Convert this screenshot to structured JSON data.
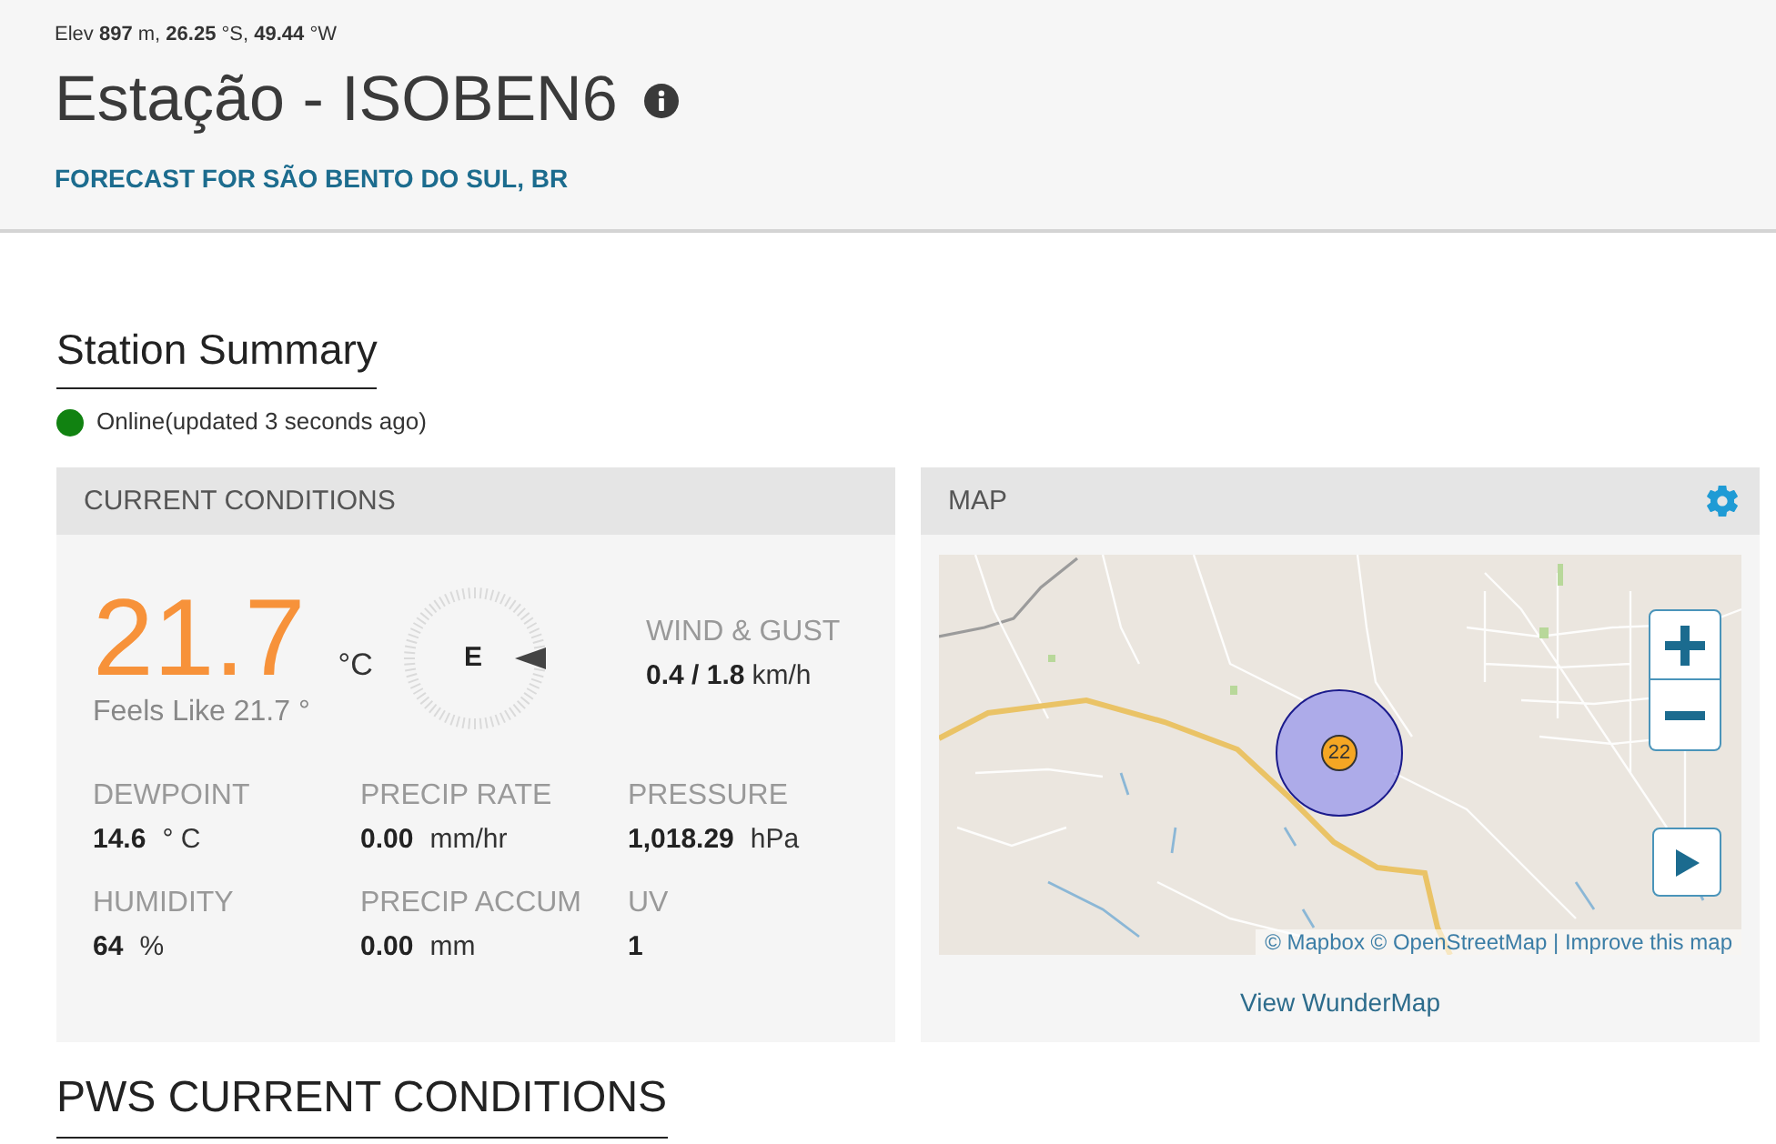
{
  "header": {
    "location": "Elev **897** m, **26.25** °S, **49.44** °W",
    "title": "Estação - ISOBEN6",
    "forecast_link": "FORECAST FOR SÃO BENTO DO SUL, BR"
  },
  "summary": {
    "heading": "Station Summary",
    "status": {
      "online": true,
      "text": "Online(updated 3 seconds ago)"
    }
  },
  "current_conditions": {
    "title": "CURRENT CONDITIONS",
    "temperature": {
      "value": "21.7",
      "unit": "°C",
      "feels_like": "Feels Like 21.7 °"
    },
    "wind": {
      "direction": "E",
      "label": "WIND & GUST",
      "value": "0.4 / 1.8",
      "unit": "km/h"
    },
    "metrics": [
      {
        "label": "DEWPOINT",
        "value": "14.6",
        "unit": "° C"
      },
      {
        "label": "PRECIP RATE",
        "value": "0.00",
        "unit": "mm/hr"
      },
      {
        "label": "PRESSURE",
        "value": "1,018.29",
        "unit": "hPa"
      },
      {
        "label": "HUMIDITY",
        "value": "64",
        "unit": "%"
      },
      {
        "label": "PRECIP ACCUM",
        "value": "0.00",
        "unit": "mm"
      },
      {
        "label": "UV",
        "value": "1"
      }
    ]
  },
  "map": {
    "title": "MAP",
    "marker": "22",
    "attribution": "© Mapbox © OpenStreetMap | Improve this map",
    "link": "View WunderMap"
  },
  "pws_heading": "PWS CURRENT CONDITIONS"
}
